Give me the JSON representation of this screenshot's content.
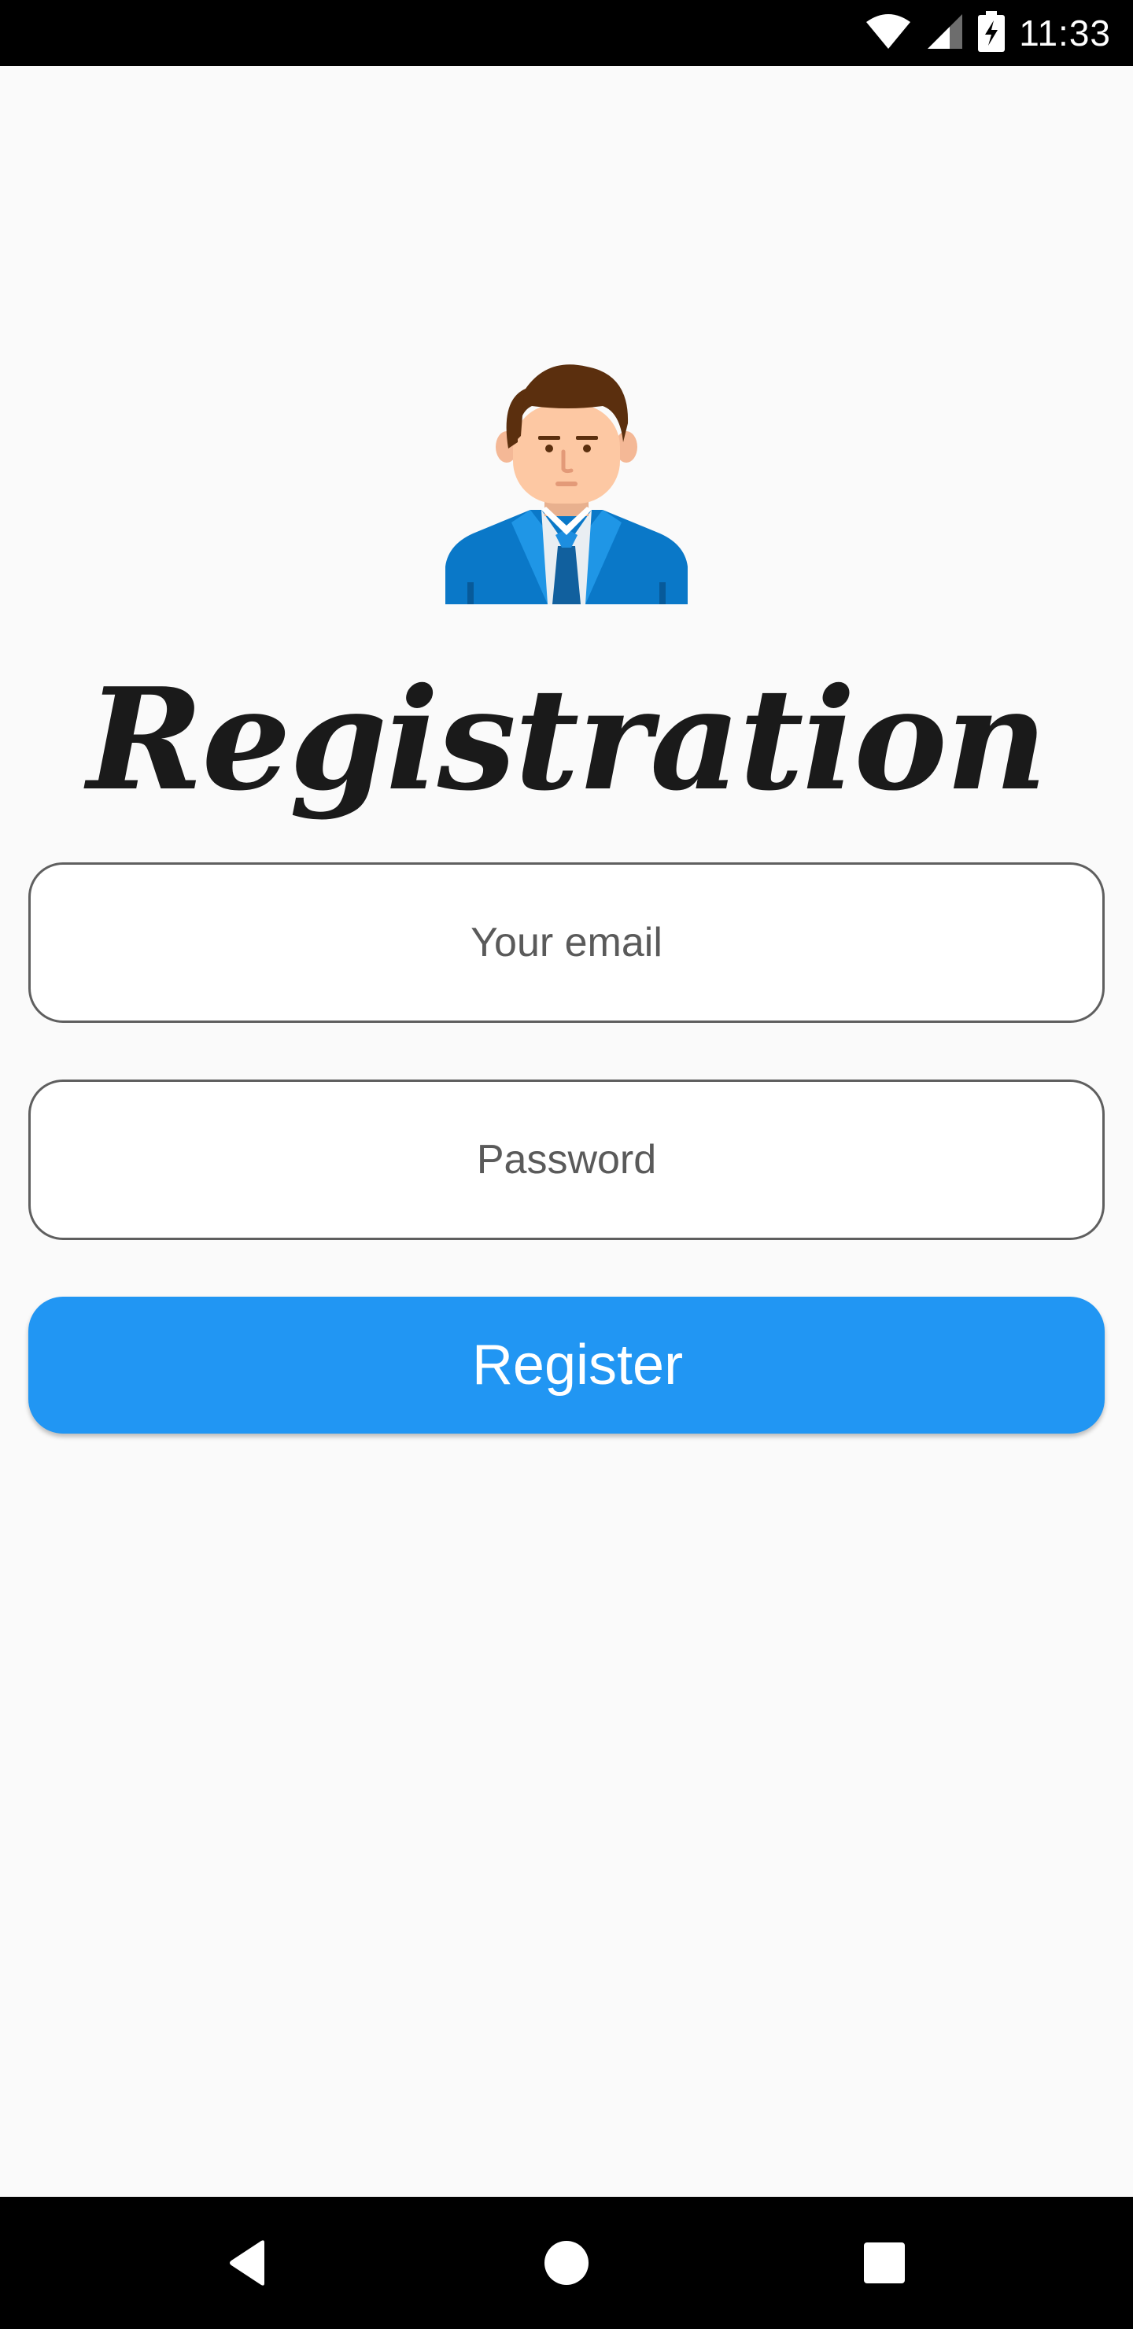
{
  "status_bar": {
    "time": "11:33",
    "icons": [
      "wifi-icon",
      "cellular-signal-icon",
      "battery-charging-icon"
    ]
  },
  "header": {
    "avatar_icon": "businessman-avatar-icon",
    "title": "Registration"
  },
  "form": {
    "email_placeholder": "Your email",
    "email_value": "",
    "password_placeholder": "Password",
    "password_value": "",
    "register_label": "Register"
  },
  "nav_bar": {
    "icons": [
      "back-icon",
      "home-icon",
      "recents-icon"
    ]
  },
  "colors": {
    "primary": "#2196f3",
    "background": "#fafafa",
    "field_border": "#5f5f5f",
    "system_bar": "#000000"
  }
}
